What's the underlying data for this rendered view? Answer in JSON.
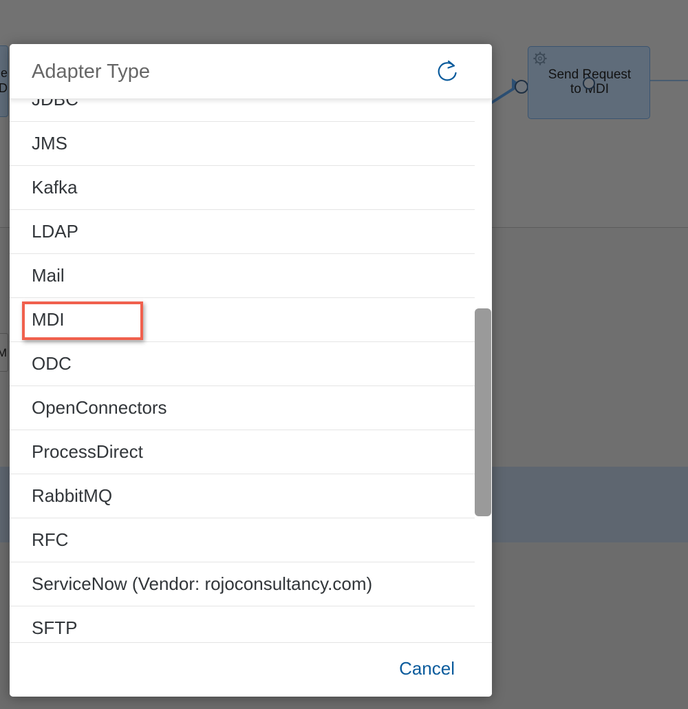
{
  "background": {
    "left_node_text": "e\nD",
    "left_small_text": "M",
    "step": {
      "label_line1": "Send Request",
      "label_line2": "to MDI"
    }
  },
  "dialog": {
    "title": "Adapter Type",
    "refresh_icon": "refresh-icon",
    "items": [
      {
        "label": "JDBC"
      },
      {
        "label": "JMS"
      },
      {
        "label": "Kafka"
      },
      {
        "label": "LDAP"
      },
      {
        "label": "Mail"
      },
      {
        "label": "MDI",
        "highlighted": true
      },
      {
        "label": "ODC"
      },
      {
        "label": "OpenConnectors"
      },
      {
        "label": "ProcessDirect"
      },
      {
        "label": "RabbitMQ"
      },
      {
        "label": "RFC"
      },
      {
        "label": "ServiceNow (Vendor: rojoconsultancy.com)"
      },
      {
        "label": "SFTP"
      }
    ],
    "cancel_label": "Cancel"
  },
  "colors": {
    "accent": "#0a5b9c",
    "highlight": "#f0604d",
    "text": "#32363a",
    "title": "#666666"
  }
}
